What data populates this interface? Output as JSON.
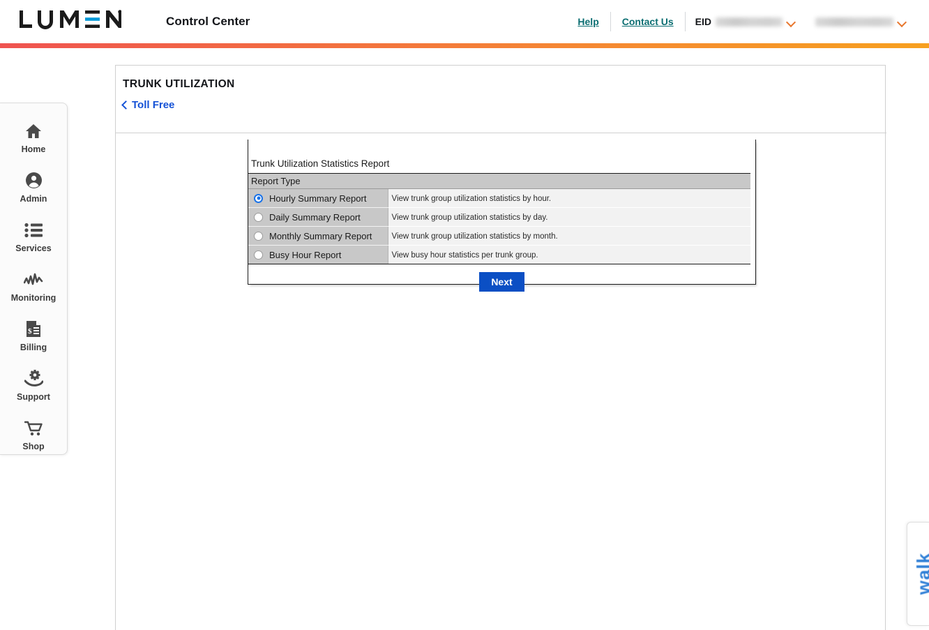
{
  "header": {
    "logo_text": "LUMEN",
    "logo_mark": "lumen-logo",
    "app_title": "Control Center",
    "help_label": "Help",
    "contact_label": "Contact Us",
    "eid_label": "EID",
    "eid_value_masked": "",
    "account_value_masked": "",
    "chevron_icon": "chevron-down-icon",
    "accent_gradient_from": "#ef5350",
    "accent_gradient_to": "#f7a01f",
    "link_color": "#0b6e72"
  },
  "sidebar": {
    "items": [
      {
        "label": "Home",
        "icon": "home-icon"
      },
      {
        "label": "Admin",
        "icon": "user-circle-icon"
      },
      {
        "label": "Services",
        "icon": "list-icon"
      },
      {
        "label": "Monitoring",
        "icon": "activity-chart-icon"
      },
      {
        "label": "Billing",
        "icon": "invoice-icon"
      },
      {
        "label": "Support",
        "icon": "gear-hand-icon"
      },
      {
        "label": "Shop",
        "icon": "shopping-cart-icon"
      }
    ]
  },
  "page": {
    "title": "TRUNK UTILIZATION",
    "back_link": "Toll Free",
    "back_icon": "chevron-left-icon",
    "back_link_color": "#1552d6"
  },
  "report_panel": {
    "title": "Trunk Utilization Statistics Report",
    "column_header": "Report Type",
    "options": [
      {
        "label": "Hourly Summary Report",
        "description": "View trunk group utilization statistics by hour.",
        "selected": true
      },
      {
        "label": "Daily Summary Report",
        "description": "View trunk group utilization statistics by day.",
        "selected": false
      },
      {
        "label": "Monthly Summary Report",
        "description": "View trunk group utilization statistics by month.",
        "selected": false
      },
      {
        "label": "Busy Hour Report",
        "description": "View busy hour statistics per trunk group.",
        "selected": false
      }
    ],
    "next_label": "Next",
    "next_color": "#0b4fc4"
  },
  "walkme": {
    "label": "walk",
    "color": "#2f7fd6"
  }
}
